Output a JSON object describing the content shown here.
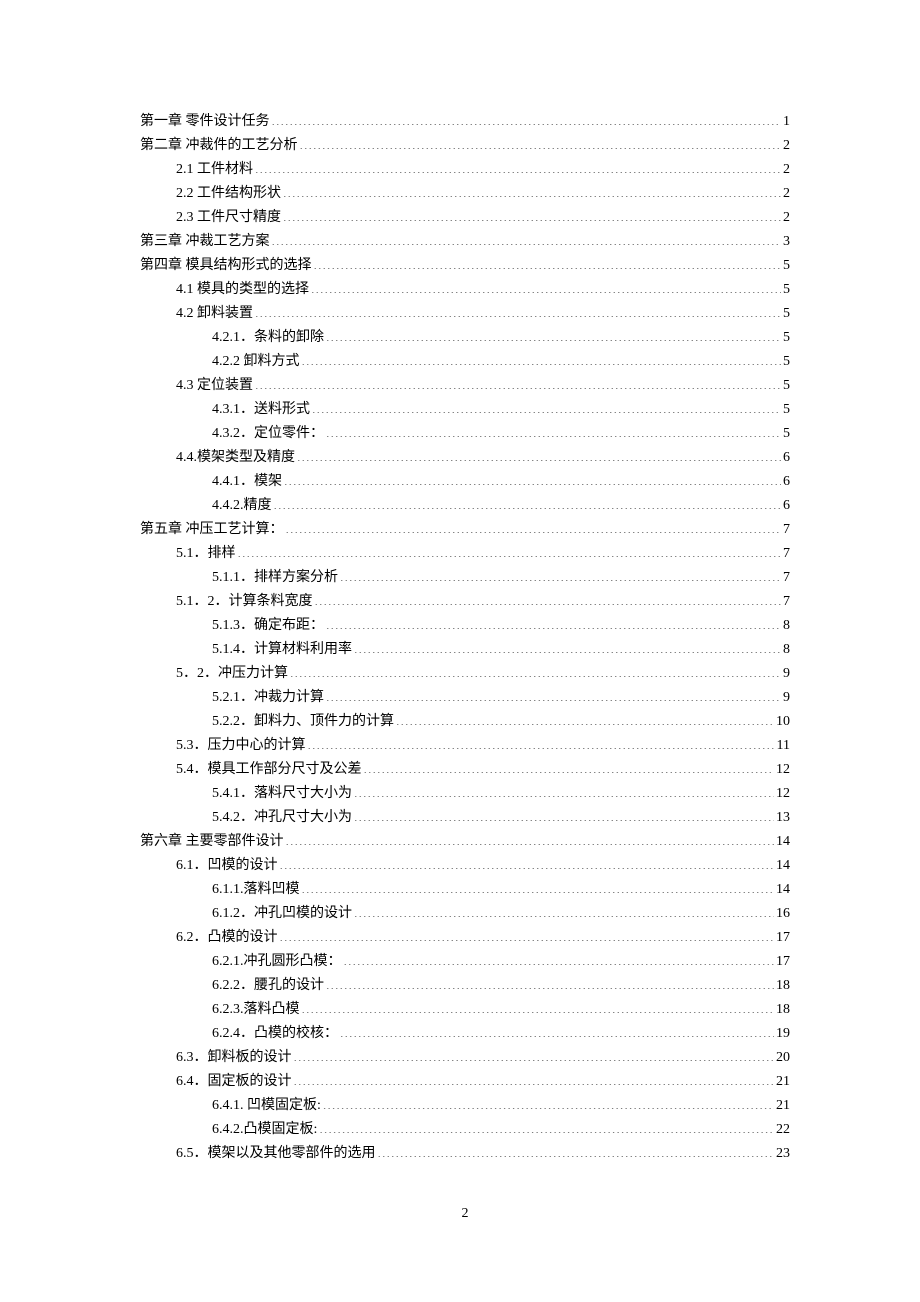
{
  "page_number": "2",
  "toc": [
    {
      "level": 0,
      "label": "第一章  零件设计任务",
      "page": "1"
    },
    {
      "level": 0,
      "label": "第二章  冲裁件的工艺分析",
      "page": "2"
    },
    {
      "level": 1,
      "label": "2.1 工件材料",
      "page": "2"
    },
    {
      "level": 1,
      "label": "2.2 工件结构形状",
      "page": "2"
    },
    {
      "level": 1,
      "label": "2.3 工件尺寸精度",
      "page": "2"
    },
    {
      "level": 0,
      "label": "第三章  冲裁工艺方案",
      "page": "3"
    },
    {
      "level": 0,
      "label": "第四章  模具结构形式的选择",
      "page": "5"
    },
    {
      "level": 1,
      "label": "4.1 模具的类型的选择",
      "page": "5"
    },
    {
      "level": 1,
      "label": "4.2 卸料装置",
      "page": "5"
    },
    {
      "level": 2,
      "label": "4.2.1．条料的卸除",
      "page": "5"
    },
    {
      "level": 2,
      "label": "4.2.2 卸料方式",
      "page": "5"
    },
    {
      "level": 1,
      "label": "4.3 定位装置",
      "page": "5"
    },
    {
      "level": 2,
      "label": "4.3.1．送料形式",
      "page": "5"
    },
    {
      "level": 2,
      "label": "4.3.2．定位零件：",
      "page": "5"
    },
    {
      "level": 1,
      "label": "4.4.模架类型及精度",
      "page": "6"
    },
    {
      "level": 2,
      "label": "4.4.1．模架",
      "page": "6"
    },
    {
      "level": 2,
      "label": "4.4.2.精度",
      "page": "6"
    },
    {
      "level": 0,
      "label": "第五章  冲压工艺计算：",
      "page": "7"
    },
    {
      "level": 1,
      "label": "5.1．排样",
      "page": "7"
    },
    {
      "level": 2,
      "label": "5.1.1．排样方案分析",
      "page": "7"
    },
    {
      "level": 1,
      "label": "5.1．2．计算条料宽度",
      "page": "7"
    },
    {
      "level": 2,
      "label": "5.1.3．确定布距：",
      "page": "8"
    },
    {
      "level": 2,
      "label": "5.1.4．计算材料利用率",
      "page": "8"
    },
    {
      "level": 1,
      "label": "5．2．冲压力计算",
      "page": "9"
    },
    {
      "level": 2,
      "label": "5.2.1．冲裁力计算",
      "page": "9"
    },
    {
      "level": 2,
      "label": "5.2.2．卸料力、顶件力的计算",
      "page": "10"
    },
    {
      "level": 1,
      "label": "5.3．压力中心的计算",
      "page": "11"
    },
    {
      "level": 1,
      "label": "5.4．模具工作部分尺寸及公差",
      "page": "12"
    },
    {
      "level": 2,
      "label": "5.4.1．落料尺寸大小为",
      "page": "12"
    },
    {
      "level": 2,
      "label": "5.4.2．冲孔尺寸大小为",
      "page": "13"
    },
    {
      "level": 0,
      "label": "第六章    主要零部件设计",
      "page": "14"
    },
    {
      "level": 1,
      "label": "6.1．凹模的设计",
      "page": "14"
    },
    {
      "level": 2,
      "label": "6.1.1.落料凹模",
      "page": "14"
    },
    {
      "level": 2,
      "label": "6.1.2．冲孔凹模的设计",
      "page": "16"
    },
    {
      "level": 1,
      "label": "6.2．凸模的设计",
      "page": "17"
    },
    {
      "level": 2,
      "label": "6.2.1.冲孔圆形凸模：",
      "page": "17"
    },
    {
      "level": 2,
      "label": "6.2.2．腰孔的设计",
      "page": "18"
    },
    {
      "level": 2,
      "label": "6.2.3.落料凸模",
      "page": "18"
    },
    {
      "level": 2,
      "label": "6.2.4．凸模的校核：",
      "page": "19"
    },
    {
      "level": 1,
      "label": "6.3．卸料板的设计",
      "page": "20"
    },
    {
      "level": 1,
      "label": "6.4．固定板的设计",
      "page": "21"
    },
    {
      "level": 2,
      "label": "6.4.1. 凹模固定板:",
      "page": "21"
    },
    {
      "level": 2,
      "label": "6.4.2.凸模固定板:",
      "page": "22"
    },
    {
      "level": 1,
      "label": "6.5．模架以及其他零部件的选用",
      "page": "23"
    }
  ]
}
